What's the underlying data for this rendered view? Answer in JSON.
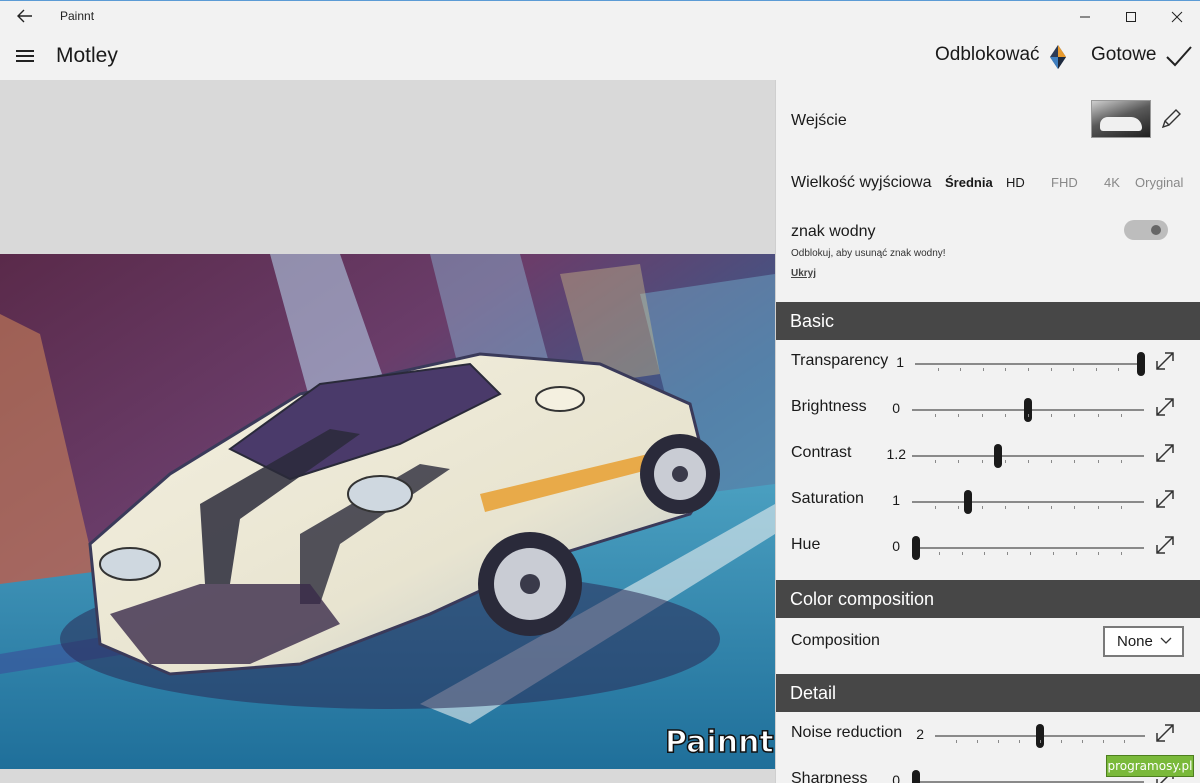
{
  "window": {
    "title": "Painnt"
  },
  "appbar": {
    "title": "Motley",
    "unlock_label": "Odblokować",
    "done_label": "Gotowe"
  },
  "artwork": {
    "watermark_text": "Painnt"
  },
  "panel": {
    "input_label": "Wejście",
    "output_size_label": "Wielkość wyjściowa",
    "output_sizes": [
      "Średnia",
      "HD",
      "FHD",
      "4K",
      "Oryginal"
    ],
    "output_size_selected": "Średnia",
    "watermark_label": "znak wodny",
    "watermark_hint": "Odblokuj, aby usunąć znak wodny!",
    "watermark_toggle_on": false,
    "hide_link": "Ukryj",
    "sections": {
      "basic": "Basic",
      "color_composition": "Color composition",
      "detail": "Detail"
    },
    "basic_sliders": [
      {
        "label": "Transparency",
        "value": "1",
        "position": 1.0
      },
      {
        "label": "Brightness",
        "value": "0",
        "position": 0.5
      },
      {
        "label": "Contrast",
        "value": "1.2",
        "position": 0.37
      },
      {
        "label": "Saturation",
        "value": "1",
        "position": 0.24
      },
      {
        "label": "Hue",
        "value": "0",
        "position": 0.0
      }
    ],
    "composition": {
      "label": "Composition",
      "selected": "None"
    },
    "detail_sliders": [
      {
        "label": "Noise reduction",
        "value": "2",
        "position": 0.5
      },
      {
        "label": "Sharpness",
        "value": "0",
        "position": 0.0
      }
    ]
  },
  "site_badge": "programosy.pl",
  "colors": {
    "accent_dark": "#474747",
    "panel_bg": "#f2f2f2",
    "canvas_bg": "#d9d9d9",
    "badge_green": "#7ab93a"
  }
}
